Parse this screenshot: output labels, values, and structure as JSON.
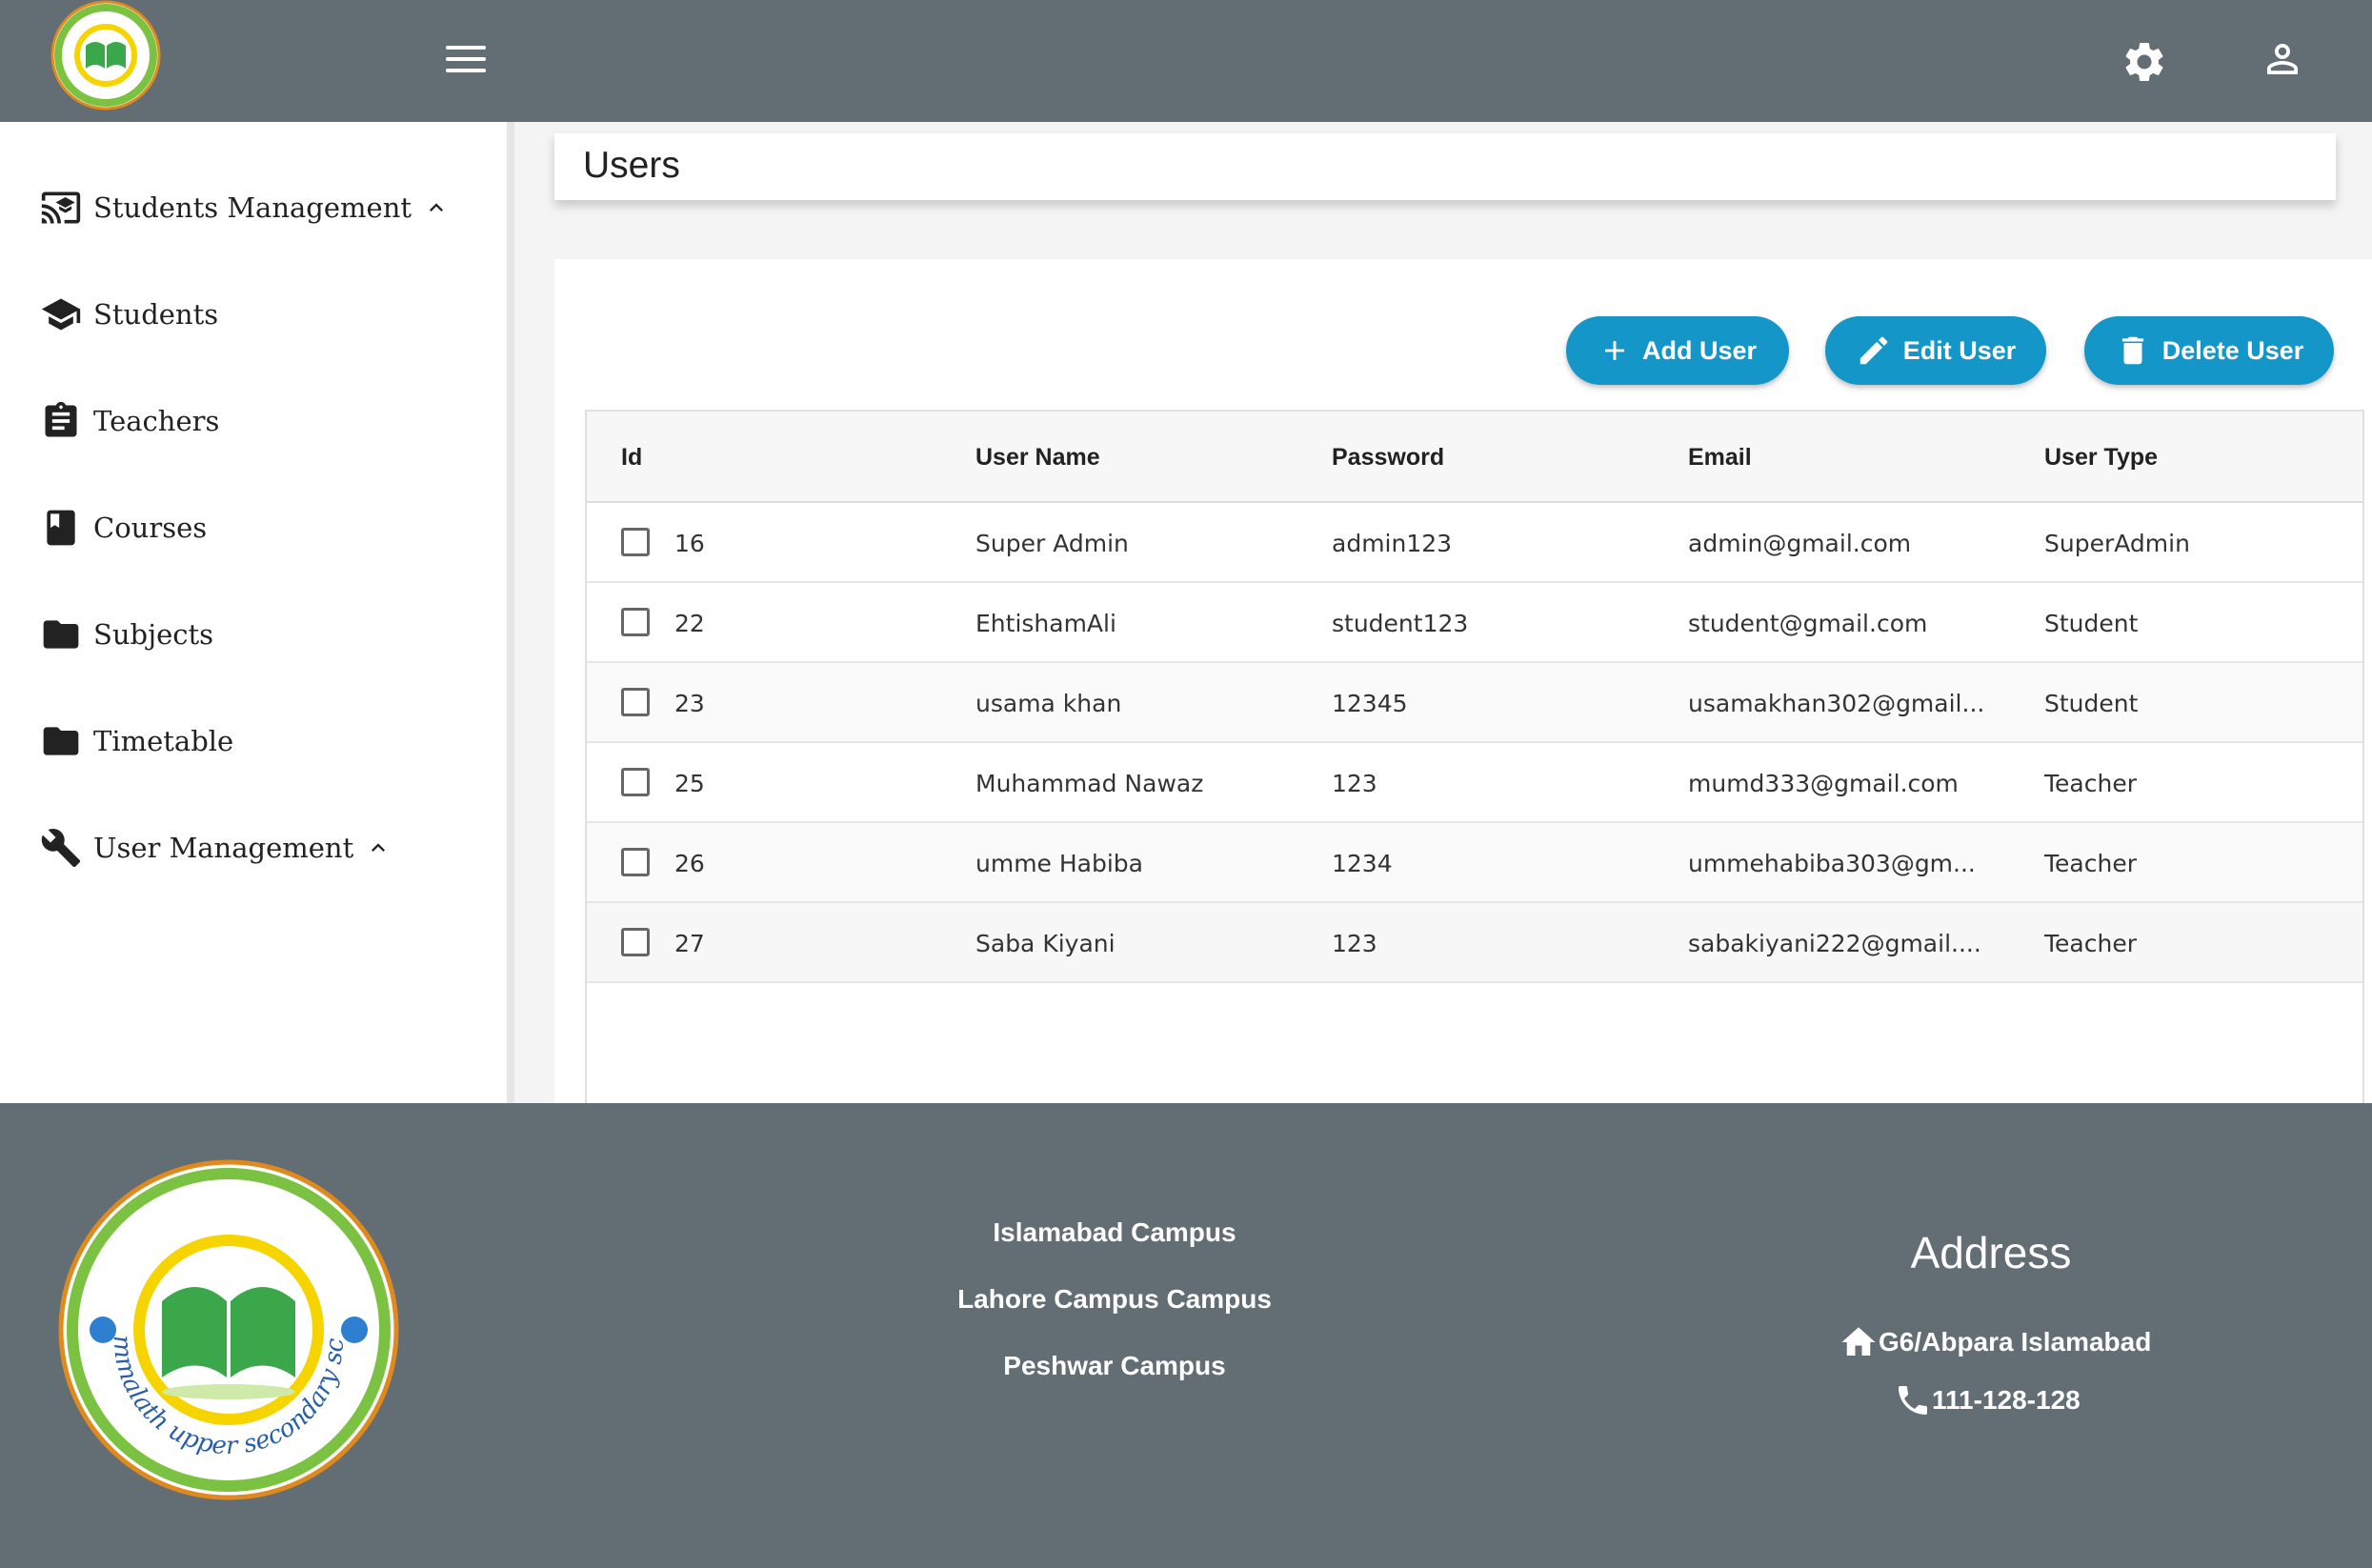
{
  "header": {
    "menu_icon": "menu-icon",
    "settings_icon": "settings-icon",
    "user_icon": "user-icon"
  },
  "sidebar": {
    "items": [
      {
        "label": "Students Management",
        "icon": "cast-for-education-icon",
        "expanded": true
      },
      {
        "label": "Students",
        "icon": "school-icon"
      },
      {
        "label": "Teachers",
        "icon": "assignment-icon"
      },
      {
        "label": "Courses",
        "icon": "book-icon"
      },
      {
        "label": "Subjects",
        "icon": "folder-icon"
      },
      {
        "label": "Timetable",
        "icon": "folder-icon"
      },
      {
        "label": "User Management",
        "icon": "wrench-icon",
        "expanded": true
      }
    ]
  },
  "main": {
    "page_title": "Users",
    "buttons": {
      "add": "Add User",
      "edit": "Edit User",
      "delete": "Delete User"
    },
    "table": {
      "columns": [
        "Id",
        "User Name",
        "Password",
        "Email",
        "User Type"
      ],
      "rows": [
        {
          "id": "16",
          "name": "Super Admin",
          "password": "admin123",
          "email": "admin@gmail.com",
          "type": "SuperAdmin"
        },
        {
          "id": "22",
          "name": "EhtishamAli",
          "password": "student123",
          "email": "student@gmail.com",
          "type": "Student"
        },
        {
          "id": "23",
          "name": "usama khan",
          "password": "12345",
          "email": "usamakhan302@gmail...",
          "type": "Student"
        },
        {
          "id": "25",
          "name": "Muhammad Nawaz",
          "password": "123",
          "email": "mumd333@gmail.com",
          "type": "Teacher"
        },
        {
          "id": "26",
          "name": "umme Habiba",
          "password": "1234",
          "email": "ummehabiba303@gm...",
          "type": "Teacher"
        },
        {
          "id": "27",
          "name": "Saba Kiyani",
          "password": "123",
          "email": "sabakiyani222@gmail....",
          "type": "Teacher"
        }
      ]
    }
  },
  "footer": {
    "campuses": [
      "Islamabad Campus",
      "Lahore Campus Campus",
      "Peshwar Campus"
    ],
    "address_title": "Address",
    "address": "G6/Abpara Islamabad",
    "phone": "111-128-128",
    "logo_text_english": "Ghommalath upper secondary school"
  },
  "colors": {
    "header_bg": "#636d74",
    "accent": "#1497c8",
    "sidebar_bg": "#ffffff"
  }
}
